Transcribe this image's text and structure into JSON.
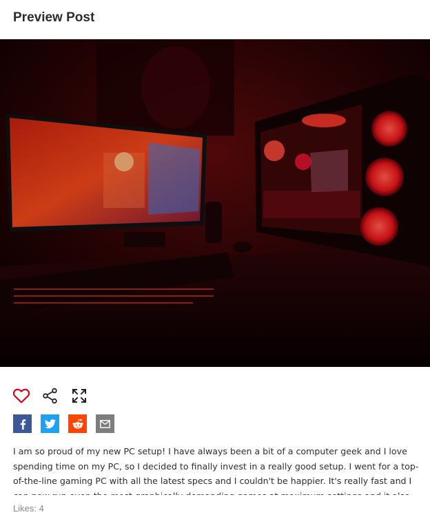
{
  "header": {
    "title": "Preview Post"
  },
  "image": {
    "subject": "red-lit gaming pc setup photo"
  },
  "actions": {
    "like_icon": "heart-outline-icon",
    "share_icon": "share-icon",
    "expand_icon": "fullscreen-icon"
  },
  "share_buttons": [
    {
      "name": "facebook",
      "icon": "facebook-icon",
      "color": "#3b5998"
    },
    {
      "name": "twitter",
      "icon": "twitter-icon",
      "color": "#1da1f2"
    },
    {
      "name": "reddit",
      "icon": "reddit-icon",
      "color": "#ff4500"
    },
    {
      "name": "email",
      "icon": "mail-icon",
      "color": "#7d7d7d"
    }
  ],
  "post": {
    "body": "I am so proud of my new PC setup! I have always been a bit of a computer geek and I love spending time on my PC, so I decided to finally invest in a really good setup. I went for a top-of-the-line gaming PC with all the latest specs and I couldn't be happier. It's really fast and I can now run even the most graphically demanding games at maximum settings and it also makes everything so much smoother."
  },
  "likes": {
    "label": "Likes: 4"
  },
  "colors": {
    "accent": "#d0021b",
    "text": "#2e2e2e",
    "muted": "#8a8a8a"
  }
}
